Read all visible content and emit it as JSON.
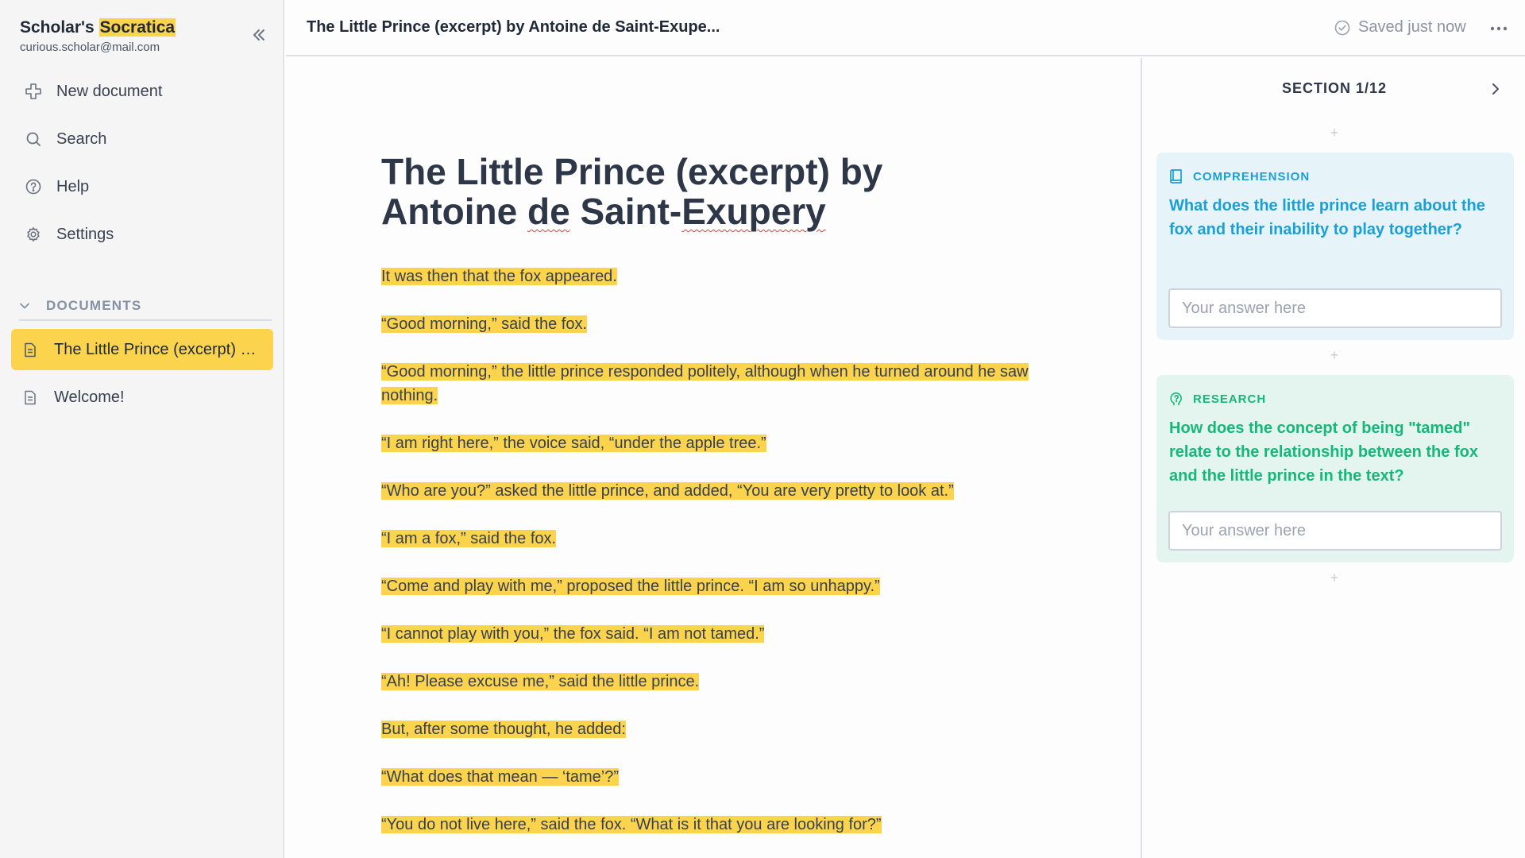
{
  "sidebar": {
    "brand_prefix": "Scholar's",
    "brand_highlight": "Socratica",
    "account_email": "curious.scholar@mail.com",
    "nav": {
      "new_document": "New document",
      "search": "Search",
      "help": "Help",
      "settings": "Settings"
    },
    "documents_header": "DOCUMENTS",
    "documents": [
      {
        "label": "The Little Prince (excerpt) by Antoine de Saint-Exupery",
        "active": true
      },
      {
        "label": "Welcome!",
        "active": false
      }
    ]
  },
  "topbar": {
    "doc_title": "The Little Prince (excerpt) by Antoine de Saint-Exupe...",
    "saved_status": "Saved just now"
  },
  "editor": {
    "heading_line1": "The Little Prince (excerpt) by",
    "heading_line2_a": "Antoine ",
    "heading_line2_b": "de",
    "heading_line2_c": " Saint-",
    "heading_line2_d": "Exupery",
    "paragraphs": [
      "It was then that the fox appeared.",
      "“Good morning,” said the fox.",
      "“Good morning,” the little prince responded politely, although when he turned around he saw nothing.",
      "“I am right here,” the voice said, “under the apple tree.”",
      "“Who are you?” asked the little prince, and added, “You are very pretty to look at.”",
      "“I am a fox,” said the fox.",
      "“Come and play with me,” proposed the little prince. “I am so unhappy.”",
      "“I cannot play with you,” the fox said. “I am not tamed.”",
      "“Ah! Please excuse me,” said the little prince.",
      "But, after some thought, he added:",
      "“What does that mean — ‘tame’?”",
      "“You do not live here,” said the fox. “What is it that you are looking for?”"
    ]
  },
  "panel": {
    "section_label": "SECTION 1/12",
    "add_symbol": "+",
    "cards": [
      {
        "tag": "COMPREHENSION",
        "question": "What does the little prince learn about the fox and their inability to play together?",
        "answer_placeholder": "Your answer here",
        "answer_value": "",
        "color": "#1a9fd6",
        "background": "#e6f4fa"
      },
      {
        "tag": "RESEARCH",
        "question": "How does the concept of being \"tamed\" relate to the relationship between the fox and the little prince in the text?",
        "answer_placeholder": "Your answer here",
        "answer_value": "",
        "color": "#14b87a",
        "background": "#e3f5ee"
      }
    ]
  },
  "colors": {
    "highlight": "#fcd34d",
    "sidebar_bg": "#f5f5f5",
    "text": "#2d3748"
  },
  "icons": {
    "collapse": "double-chevron-left-icon",
    "new_document": "plus-outline-icon",
    "search": "search-icon",
    "help": "help-circle-icon",
    "settings": "gear-icon",
    "documents_toggle": "chevron-down-icon",
    "document": "document-icon",
    "saved": "check-circle-icon",
    "more": "ellipsis-icon",
    "next": "chevron-right-icon",
    "comprehension": "book-icon",
    "research": "research-bulb-icon"
  }
}
